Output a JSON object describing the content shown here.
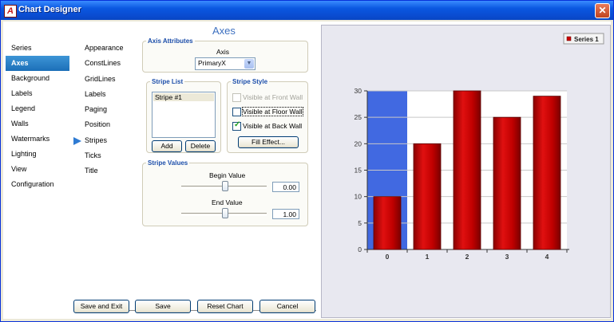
{
  "window": {
    "title": "Chart Designer",
    "app_icon": "A"
  },
  "nav_primary": [
    {
      "label": "Series"
    },
    {
      "label": "Axes",
      "selected": true
    },
    {
      "label": "Background"
    },
    {
      "label": "Labels"
    },
    {
      "label": "Legend"
    },
    {
      "label": "Walls"
    },
    {
      "label": "Watermarks"
    },
    {
      "label": "Lighting"
    },
    {
      "label": "View"
    },
    {
      "label": "Configuration"
    }
  ],
  "nav_secondary": [
    {
      "label": "Appearance"
    },
    {
      "label": "ConstLines"
    },
    {
      "label": "GridLines"
    },
    {
      "label": "Labels"
    },
    {
      "label": "Paging"
    },
    {
      "label": "Position"
    },
    {
      "label": "Stripes",
      "selected": true
    },
    {
      "label": "Ticks"
    },
    {
      "label": "Title"
    }
  ],
  "panel": {
    "heading": "Axes",
    "axis_attributes": {
      "legend": "Axis Attributes",
      "axis_label": "Axis",
      "axis_value": "PrimaryX"
    },
    "stripe_list": {
      "legend": "Stripe List",
      "items": [
        "Stripe #1"
      ],
      "add_label": "Add",
      "delete_label": "Delete"
    },
    "stripe_style": {
      "legend": "Stripe Style",
      "front_wall": {
        "label": "Visible at Front Wall",
        "checked": false,
        "disabled": true
      },
      "floor_wall": {
        "label": "Visible at Floor Wall",
        "checked": false,
        "disabled": false
      },
      "back_wall": {
        "label": "Visible at Back Wall",
        "checked": true,
        "disabled": false
      },
      "fill_effect_label": "Fill Effect..."
    },
    "stripe_values": {
      "legend": "Stripe Values",
      "begin_label": "Begin Value",
      "begin_value": "0.00",
      "begin_slider": 0.5,
      "end_label": "End Value",
      "end_value": "1.00",
      "end_slider": 0.5
    }
  },
  "footer": {
    "save_exit_label": "Save and Exit",
    "save_label": "Save",
    "reset_label": "Reset Chart",
    "cancel_label": "Cancel"
  },
  "chart_data": {
    "type": "bar",
    "categories": [
      "0",
      "1",
      "2",
      "3",
      "4"
    ],
    "series": [
      {
        "name": "Series 1",
        "values": [
          10,
          20,
          30,
          25,
          29
        ],
        "color": "#cc0000"
      }
    ],
    "ylim": [
      0,
      30
    ],
    "yticks": [
      0,
      5,
      10,
      15,
      20,
      25,
      30
    ],
    "stripe": {
      "begin": 0,
      "end": 1,
      "color": "#4169e1"
    },
    "grid": true,
    "legend": "top-right",
    "background": "#e8e8f0"
  }
}
